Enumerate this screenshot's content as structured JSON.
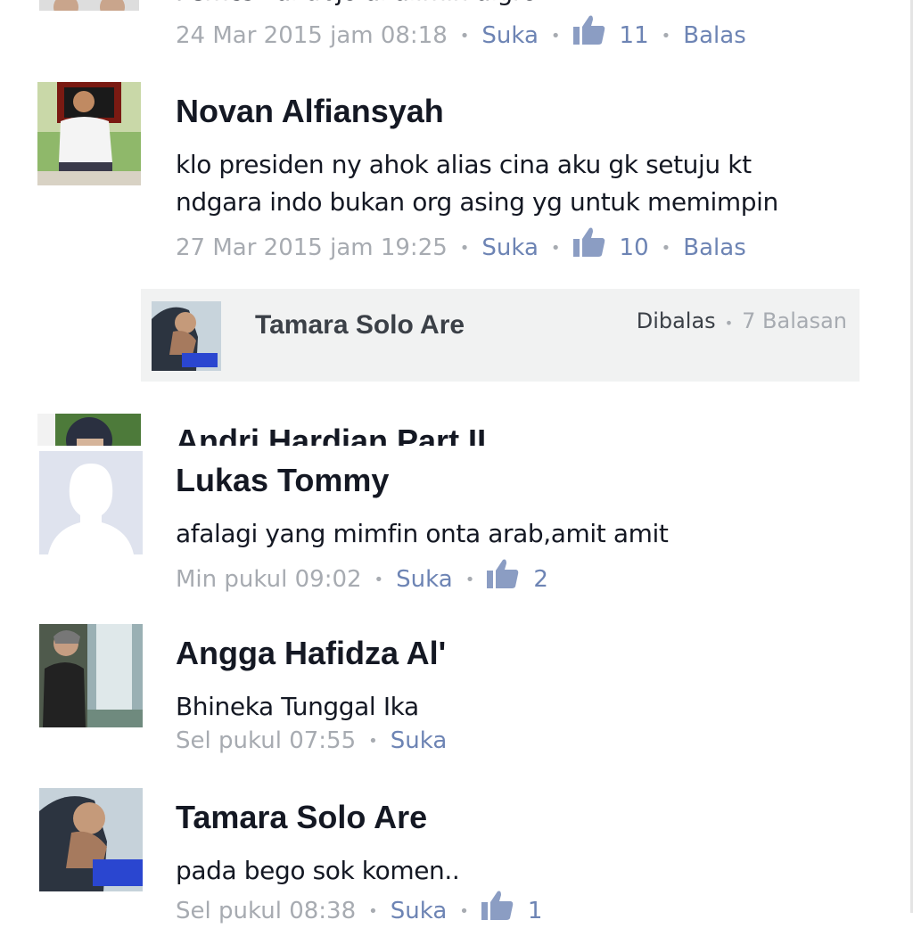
{
  "colors": {
    "link": "#6d84b4",
    "meta": "#a7abb1",
    "name": "#141823",
    "reply_bg": "#f1f2f2"
  },
  "top_partial": {
    "text": "Pemcs kal ubjo al alimin algro",
    "date": "24 Mar 2015 jam 08:18",
    "like_label": "Suka",
    "like_count": "11",
    "reply_label": "Balas"
  },
  "comments": [
    {
      "name": "Novan Alfiansyah",
      "text_lines": [
        "klo presiden ny ahok alias cina aku gk setuju kt",
        "ndgara indo bukan org asing yg untuk memimpin"
      ],
      "date": "27 Mar 2015 jam 19:25",
      "like_label": "Suka",
      "like_count": "10",
      "reply_label": "Balas",
      "avatar_icon": "person-photo-icon",
      "reply_summary": {
        "name": "Tamara Solo Are",
        "replied_label": "Dibalas",
        "count_label": "7 Balasan"
      }
    },
    {
      "name": "Andri Hardian Part II"
    },
    {
      "name": "Lukas Tommy",
      "text": "afalagi yang mimfin onta arab,amit amit",
      "date": "Min pukul 09:02",
      "like_label": "Suka",
      "like_count": "2",
      "avatar_icon": "default-profile-silhouette-icon"
    },
    {
      "name": "Angga Hafidza Al'",
      "text": "Bhineka Tunggal Ika",
      "date": "Sel pukul 07:55",
      "like_label": "Suka"
    },
    {
      "name": "Tamara Solo Are",
      "text": "pada bego sok komen..",
      "date": "Sel pukul 08:38",
      "like_label": "Suka",
      "like_count": "1"
    }
  ]
}
